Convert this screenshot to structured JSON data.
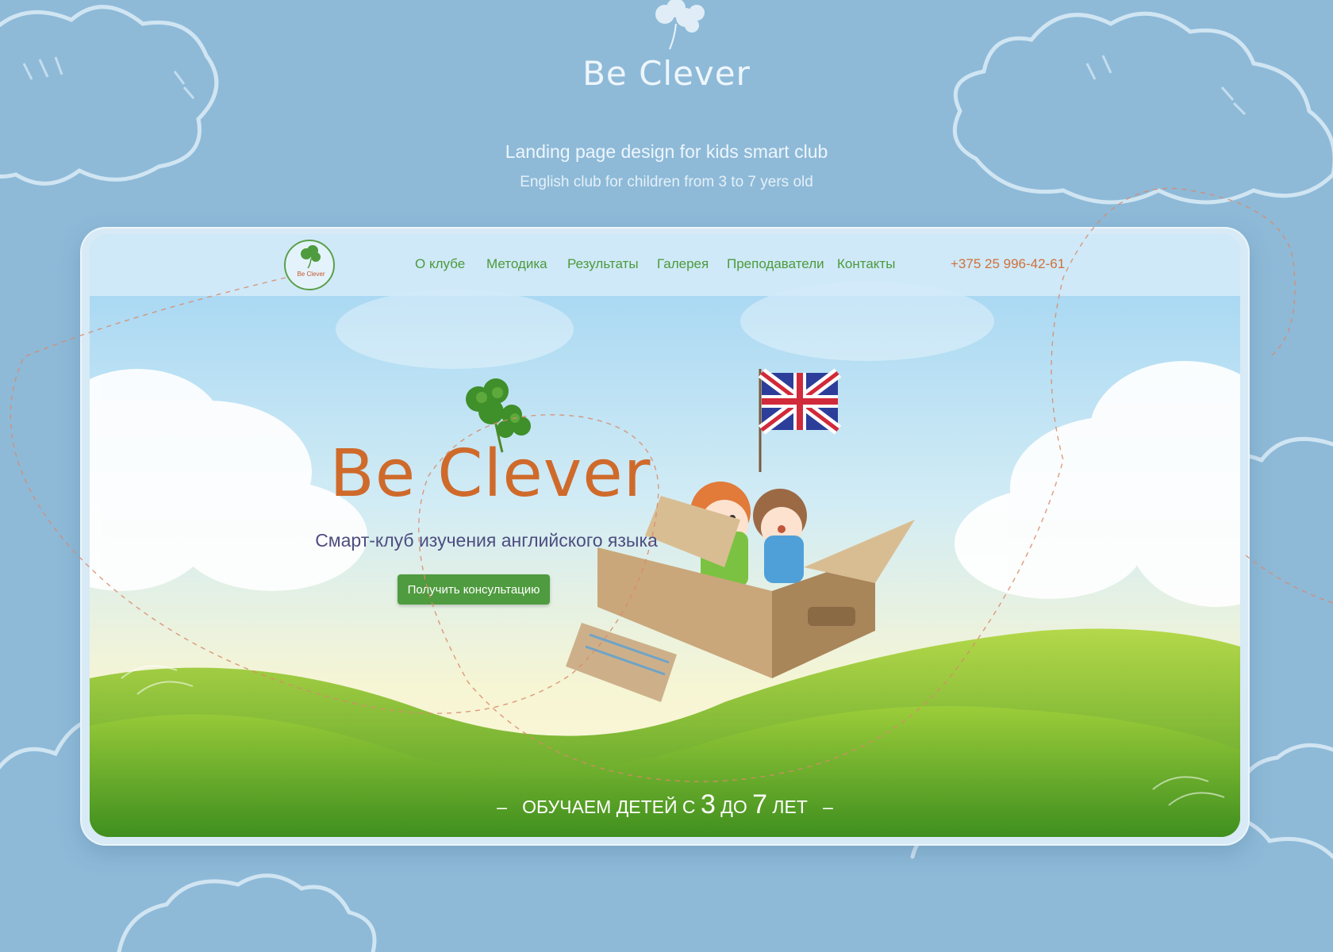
{
  "presentation": {
    "brand": "Be Clever",
    "subtitle": "Landing page design for kids smart club",
    "caption": "English club for children from 3 to 7 yers old"
  },
  "site": {
    "logo_text": "Be Clever",
    "nav": [
      {
        "label": "О клубе"
      },
      {
        "label": "Методика"
      },
      {
        "label": "Результаты"
      },
      {
        "label": "Галерея"
      },
      {
        "label": "Преподаватели"
      },
      {
        "label": "Контакты"
      }
    ],
    "phone": "+375 25 996-42-61",
    "hero": {
      "title": "Be Clever",
      "subtitle": "Смарт-клуб изучения английского языка",
      "cta_label": "Получить консультацию"
    },
    "bottom": {
      "dash_left": "–",
      "prefix": "ОБУЧАЕМ ДЕТЕЙ С",
      "age_from": "3",
      "mid": "ДО",
      "age_to": "7",
      "suffix": "ЛЕТ",
      "dash_right": "–"
    }
  },
  "colors": {
    "page_bg": "#8ebad8",
    "accent_orange": "#cf6a2b",
    "accent_green": "#4f9b3f",
    "nav_text": "#4c9a3c",
    "phone_text": "#d0703a",
    "hero_subtitle": "#4d4d80"
  }
}
